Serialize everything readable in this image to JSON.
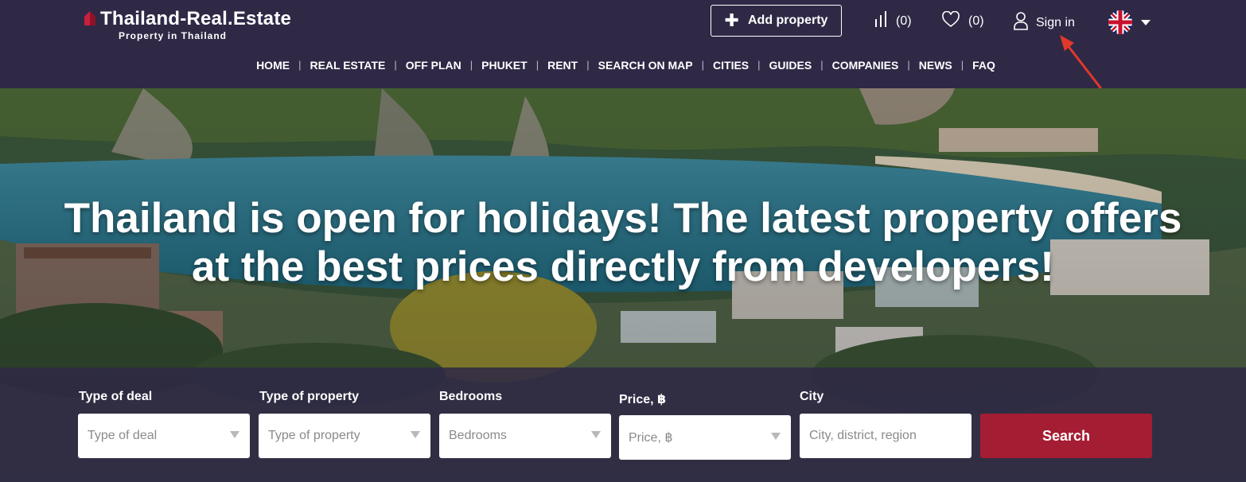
{
  "header": {
    "logo_title": "Thailand-Real.Estate",
    "logo_subtitle": "Property in Thailand",
    "add_property_label": "Add property",
    "compare_count": "(0)",
    "favorites_count": "(0)",
    "sign_in_label": "Sign in",
    "language_flag": "uk-flag-icon"
  },
  "nav": {
    "items": [
      "HOME",
      "REAL ESTATE",
      "OFF PLAN",
      "PHUKET",
      "RENT",
      "SEARCH ON MAP",
      "CITIES",
      "GUIDES",
      "COMPANIES",
      "NEWS",
      "FAQ"
    ],
    "separator": "|"
  },
  "hero": {
    "title_line1": "Thailand is open for holidays! The latest property offers",
    "title_line2": "at the best prices directly from developers!"
  },
  "search": {
    "deal_label": "Type of deal",
    "deal_placeholder": "Type of deal",
    "property_label": "Type of property",
    "property_placeholder": "Type of property",
    "bedrooms_label": "Bedrooms",
    "bedrooms_placeholder": "Bedrooms",
    "price_label": "Price, ฿",
    "price_placeholder": "Price, ฿",
    "city_label": "City",
    "city_placeholder": "City, district, region",
    "button_label": "Search"
  },
  "colors": {
    "header_bg": "#2f2946",
    "search_button": "#a51d32",
    "annotation_arrow": "#e0392b"
  }
}
